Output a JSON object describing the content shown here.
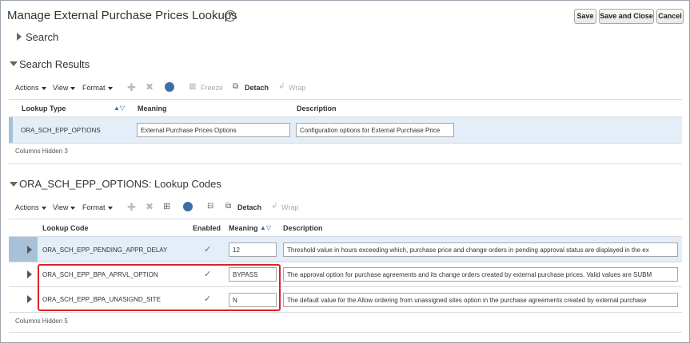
{
  "page": {
    "title": "Manage External Purchase Prices Lookups",
    "buttons": {
      "save": "Save",
      "save_close": "Save and Close",
      "cancel": "Cancel"
    }
  },
  "search": {
    "label": "Search"
  },
  "results": {
    "section_title": "Search Results",
    "toolbar": {
      "actions": "Actions",
      "view": "View",
      "format": "Format",
      "freeze": "Freeze",
      "detach": "Detach",
      "wrap": "Wrap"
    },
    "columns": {
      "lookup_type": "Lookup Type",
      "meaning": "Meaning",
      "description": "Description"
    },
    "row": {
      "lookup_type": "ORA_SCH_EPP_OPTIONS",
      "meaning": "External Purchase Prices Options",
      "description": "Configuration options for External Purchase Price"
    },
    "columns_hidden": "Columns Hidden",
    "columns_hidden_count": "3"
  },
  "codes": {
    "section_title": "ORA_SCH_EPP_OPTIONS: Lookup Codes",
    "toolbar": {
      "actions": "Actions",
      "view": "View",
      "format": "Format",
      "detach": "Detach",
      "wrap": "Wrap"
    },
    "columns": {
      "lookup_code": "Lookup Code",
      "enabled": "Enabled",
      "meaning": "Meaning",
      "description": "Description"
    },
    "rows": [
      {
        "code": "ORA_SCH_EPP_PENDING_APPR_DELAY",
        "enabled": "✓",
        "meaning": "12",
        "description": "Threshold value in hours exceeding which, purchase price and change orders in pending approval status are displayed in the ex"
      },
      {
        "code": "ORA_SCH_EPP_BPA_APRVL_OPTION",
        "enabled": "✓",
        "meaning": "BYPASS",
        "description": "The approval option for purchase agreements and its change orders created by external purchase prices. Valid values are SUBM"
      },
      {
        "code": "ORA_SCH_EPP_BPA_UNASIGND_SITE",
        "enabled": "✓",
        "meaning": "N",
        "description": "The default value for the Allow ordering from unassigned sites option in the purchase agreements created by external purchase"
      }
    ],
    "columns_hidden": "Columns Hidden",
    "columns_hidden_count": "5"
  },
  "colors": {
    "highlight": "#d8232a",
    "selected_row": "#e4eef8",
    "icon_blue": "#3d6ea8"
  }
}
